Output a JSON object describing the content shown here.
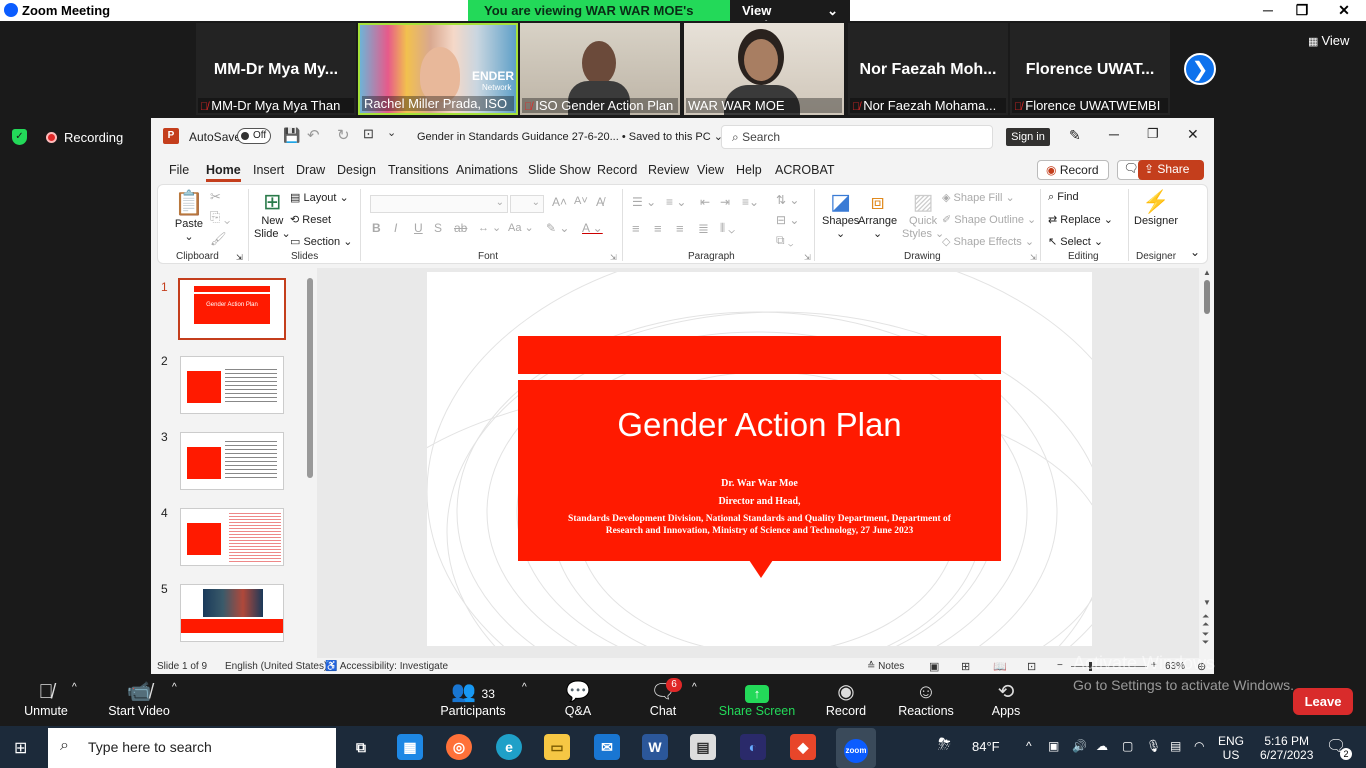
{
  "window": {
    "title": "Zoom Meeting",
    "minimize": "─",
    "restore": "❐",
    "close": "✕"
  },
  "share_banner": {
    "message": "You are viewing WAR WAR MOE's screen",
    "view_options": "View Options",
    "chevron": "⌄"
  },
  "gallery": {
    "view_label": "View",
    "next_icon": "❯",
    "participants": [
      {
        "big_name": "MM-Dr  Mya  My...",
        "label": "MM-Dr Mya Mya Than",
        "muted": true,
        "video": false
      },
      {
        "big_name": "",
        "label": "Rachel Miller Prada, ISO",
        "muted": false,
        "video": true,
        "overlay": "ENDER",
        "overlay2": "Network"
      },
      {
        "big_name": "",
        "label": "ISO Gender Action Plan",
        "muted": true,
        "video": true
      },
      {
        "big_name": "",
        "label": "WAR WAR MOE",
        "muted": false,
        "video": true
      },
      {
        "big_name": "Nor  Faezah  Moh...",
        "label": "Nor Faezah Mohama...",
        "muted": true,
        "video": false
      },
      {
        "big_name": "Florence  UWAT...",
        "label": "Florence UWATWEMBI",
        "muted": true,
        "video": false
      }
    ]
  },
  "recording": {
    "label": "Recording"
  },
  "ppt": {
    "autosave_label": "AutoSave",
    "autosave_state": "Off",
    "doc_title": "Gender in Standards Guidance 27-6-20...  •  Saved to this PC  ⌄",
    "search_placeholder": "Search",
    "sign_in": "Sign in",
    "tabs": [
      "File",
      "Home",
      "Insert",
      "Draw",
      "Design",
      "Transitions",
      "Animations",
      "Slide Show",
      "Record",
      "Review",
      "View",
      "Help",
      "ACROBAT"
    ],
    "active_tab": "Home",
    "record_btn": "Record",
    "share_btn": "Share",
    "ribbon": {
      "clipboard": {
        "label": "Clipboard",
        "paste": "Paste"
      },
      "slides": {
        "label": "Slides",
        "new_slide": "New",
        "new_slide2": "Slide ⌄",
        "layout": "Layout ⌄",
        "reset": "Reset",
        "section": "Section ⌄"
      },
      "font": {
        "label": "Font"
      },
      "paragraph": {
        "label": "Paragraph"
      },
      "drawing": {
        "label": "Drawing",
        "shapes": "Shapes",
        "arrange": "Arrange",
        "quick_styles": "Quick",
        "quick_styles2": "Styles ⌄",
        "shape_fill": "Shape Fill ⌄",
        "shape_outline": "Shape Outline ⌄",
        "shape_effects": "Shape Effects ⌄"
      },
      "editing": {
        "label": "Editing",
        "find": "Find",
        "replace": "Replace  ⌄",
        "select": "Select ⌄"
      },
      "designer": {
        "label": "Designer",
        "designer": "Designer"
      }
    },
    "thumbnails": [
      {
        "num": "1",
        "title": "Gender Action Plan",
        "selected": true
      },
      {
        "num": "2",
        "title": "What is a gender transformative approach?",
        "selected": false
      },
      {
        "num": "3",
        "title": "SDD's Commitment",
        "selected": false
      },
      {
        "num": "4",
        "title": "What are you do at SDD?",
        "selected": false
      },
      {
        "num": "5",
        "title": "",
        "selected": false
      }
    ],
    "slide": {
      "title": "Gender Action Plan",
      "author": "Dr. War War Moe",
      "role": "Director and Head,",
      "org_line1": "Standards Development Division, National Standards and Quality Department, Department of",
      "org_line2": "Research and Innovation, Ministry of Science and Technology, 27  June 2023"
    },
    "status": {
      "slide": "Slide 1 of 9",
      "language": "English (United States)",
      "accessibility": "Accessibility: Investigate",
      "notes": "Notes",
      "zoom": "63%"
    }
  },
  "controls": {
    "unmute": "Unmute",
    "start_video": "Start Video",
    "participants": "Participants",
    "participants_count": "33",
    "qa": "Q&A",
    "chat": "Chat",
    "chat_badge": "6",
    "share_screen": "Share Screen",
    "record": "Record",
    "reactions": "Reactions",
    "apps": "Apps",
    "leave": "Leave"
  },
  "watermark": {
    "line1": "Activate Windows",
    "line2": "Go to Settings to activate Windows."
  },
  "taskbar": {
    "search_placeholder": "Type here to search",
    "weather": "84°F",
    "lang1": "ENG",
    "lang2": "US",
    "time": "5:16 PM",
    "date": "6/27/2023",
    "notifications": "2"
  },
  "colors": {
    "accent_red": "#ff1a00",
    "ppt_brand": "#c43e1c",
    "zoom_green": "#23d959",
    "zoom_blue": "#0e72ed",
    "leave_red": "#d92b2b"
  }
}
